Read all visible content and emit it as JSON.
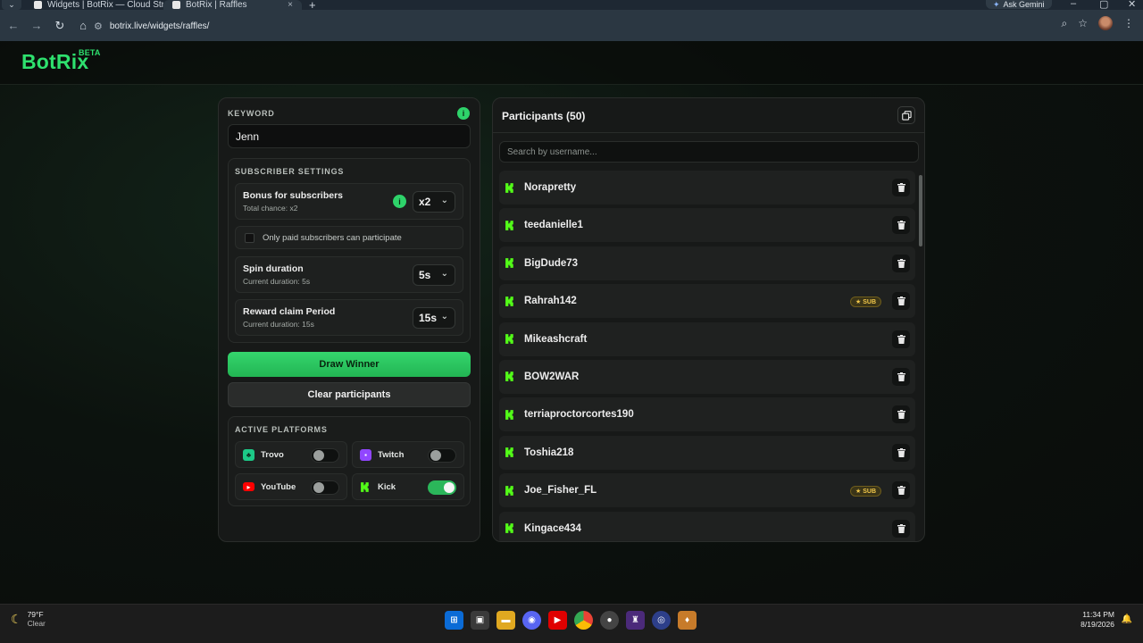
{
  "browser": {
    "tabs": [
      {
        "title": "Widgets | BotRix — Cloud Strea",
        "active": false
      },
      {
        "title": "BotRix | Raffles",
        "active": true
      }
    ],
    "new_tab": "+",
    "gemini_label": "Ask Gemini",
    "url": "botrix.live/widgets/raffles/"
  },
  "site": {
    "logo": "BotRix",
    "beta": "BETA"
  },
  "raffle": {
    "keyword_label": "KEYWORD",
    "keyword_info": "i",
    "keyword_value": "Jenn",
    "subscriber_settings_label": "SUBSCRIBER SETTINGS",
    "bonus": {
      "title": "Bonus for subscribers",
      "subtitle": "Total chance: x2",
      "info": "i",
      "value": "x2"
    },
    "paid_only_label": "Only paid subscribers can participate",
    "spin": {
      "title": "Spin duration",
      "subtitle": "Current duration: 5s",
      "value": "5s"
    },
    "reward": {
      "title": "Reward claim Period",
      "subtitle": "Current duration: 15s",
      "value": "15s"
    },
    "draw_button": "Draw Winner",
    "clear_button": "Clear participants",
    "active_platforms_label": "ACTIVE PLATFORMS",
    "platforms": [
      {
        "name": "Trovo",
        "enabled": false,
        "color": "#1cc987"
      },
      {
        "name": "Twitch",
        "enabled": false,
        "color": "#9146ff"
      },
      {
        "name": "YouTube",
        "enabled": false,
        "color": "#ff0000"
      },
      {
        "name": "Kick",
        "enabled": true,
        "color": "#53fc18"
      }
    ]
  },
  "participants": {
    "title": "Participants (50)",
    "search_placeholder": "Search by username...",
    "sub_label": "SUB",
    "items": [
      {
        "name": "Norapretty",
        "sub": false
      },
      {
        "name": "teedanielle1",
        "sub": false
      },
      {
        "name": "BigDude73",
        "sub": false
      },
      {
        "name": "Rahrah142",
        "sub": true
      },
      {
        "name": "Mikeashcraft",
        "sub": false
      },
      {
        "name": "BOW2WAR",
        "sub": false
      },
      {
        "name": "terriaproctorcortes190",
        "sub": false
      },
      {
        "name": "Toshia218",
        "sub": false
      },
      {
        "name": "Joe_Fisher_FL",
        "sub": true
      },
      {
        "name": "Kingace434",
        "sub": false
      }
    ]
  },
  "taskbar": {
    "temp": "79°F",
    "condition": "Clear",
    "time": "11:34 PM",
    "date": "8/19/2026"
  },
  "colors": {
    "accent": "#2ee06e",
    "kick": "#53fc18",
    "sub_badge": "#f2c84a"
  }
}
